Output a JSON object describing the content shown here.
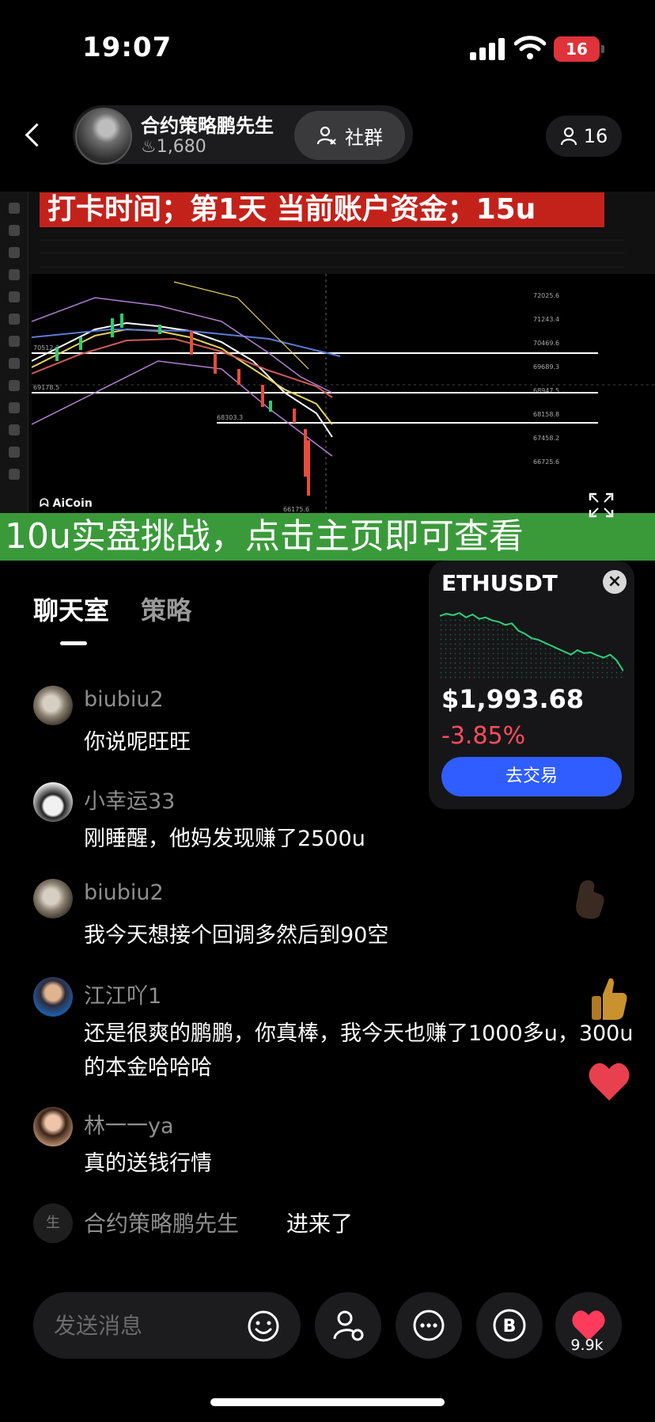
{
  "status_bar": {
    "time": "19:07",
    "battery": "16"
  },
  "header": {
    "host_name": "合约策略鹏先生",
    "likes": "1,680",
    "community_label": "社群",
    "viewer_count": "16"
  },
  "video": {
    "banner_top": "打卡时间；第1天    当前账户资金；15u",
    "banner_bottom": "10u实盘挑战，点击主页即可查看",
    "brand": "AiCoin"
  },
  "tabs": [
    "聊天室",
    "策略"
  ],
  "ticker": {
    "symbol": "ETHUSDT",
    "price": "$1,993.68",
    "change": "-3.85%",
    "trade_label": "去交易",
    "spark_color": "#2fd07a",
    "trend": [
      0.82,
      0.85,
      0.83,
      0.86,
      0.8,
      0.84,
      0.78,
      0.8,
      0.76,
      0.74,
      0.7,
      0.72,
      0.62,
      0.58,
      0.52,
      0.5,
      0.46,
      0.42,
      0.38,
      0.34,
      0.3,
      0.36,
      0.32,
      0.33,
      0.29,
      0.26,
      0.3,
      0.22,
      0.08
    ]
  },
  "chat": [
    {
      "user": "biubiu2",
      "text": "你说呢旺旺",
      "avatar": "av-cat"
    },
    {
      "user": "小幸运33",
      "text": "刚睡醒，他妈发现赚了2500u",
      "avatar": "av-girl"
    },
    {
      "user": "biubiu2",
      "text": "我今天想接个回调多然后到90空",
      "avatar": "av-cat"
    },
    {
      "user": "江江吖1",
      "text": "还是很爽的鹏鹏，你真棒，我今天也赚了1000多u，300u的本金哈哈哈",
      "avatar": "av-man"
    },
    {
      "user": "林一一ya",
      "text": "真的送钱行情",
      "avatar": "av-woman"
    }
  ],
  "join_notice": {
    "avatar_text": "生",
    "name": "合约策略鹏先生",
    "action": "进来了"
  },
  "bottom_bar": {
    "input_placeholder": "发送消息",
    "like_count": "9.9k"
  },
  "icons": {
    "back": "chevron-left-icon",
    "community": "person-add-icon",
    "viewers": "person-icon",
    "emoji": "smiley-icon",
    "link_mic": "person-mic-icon",
    "more": "ellipsis-icon",
    "coin": "bitcoin-icon",
    "like": "heart-icon"
  }
}
